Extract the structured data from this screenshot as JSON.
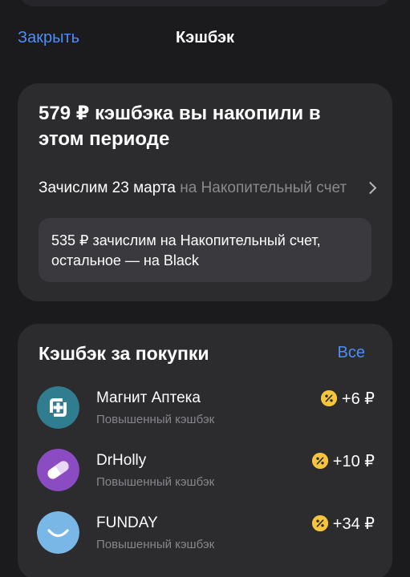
{
  "nav": {
    "close_label": "Закрыть",
    "title": "Кэшбэк"
  },
  "summary": {
    "headline": "579 ₽ кэшбэка вы накопили в этом периоде",
    "accrual_date_text": "Зачислим 23 марта",
    "accrual_destination": "на Накопительный счет",
    "note": "535 ₽ зачислим на Накопительный счет, остальное — на Black"
  },
  "purchases": {
    "title": "Кэшбэк за покупки",
    "all_label": "Все",
    "items": [
      {
        "name": "Магнит Аптека",
        "subtitle": "Повышенный кэшбэк",
        "amount": "+6 ₽",
        "icon": "magnit-apteka-logo-icon",
        "icon_color": "#2f7d8f"
      },
      {
        "name": "DrHolly",
        "subtitle": "Повышенный кэшбэк",
        "amount": "+10 ₽",
        "icon": "pill-icon",
        "icon_color": "#8b4bc2"
      },
      {
        "name": "FUNDAY",
        "subtitle": "Повышенный кэшбэк",
        "amount": "+34 ₽",
        "icon": "smile-icon",
        "icon_color": "#79b8e6"
      }
    ]
  },
  "colors": {
    "background": "#1b1b1d",
    "card": "#2c2c2f",
    "accent_blue": "#4c8ef7",
    "secondary_text": "#86868b",
    "cashback_badge": "#f6c53d"
  }
}
